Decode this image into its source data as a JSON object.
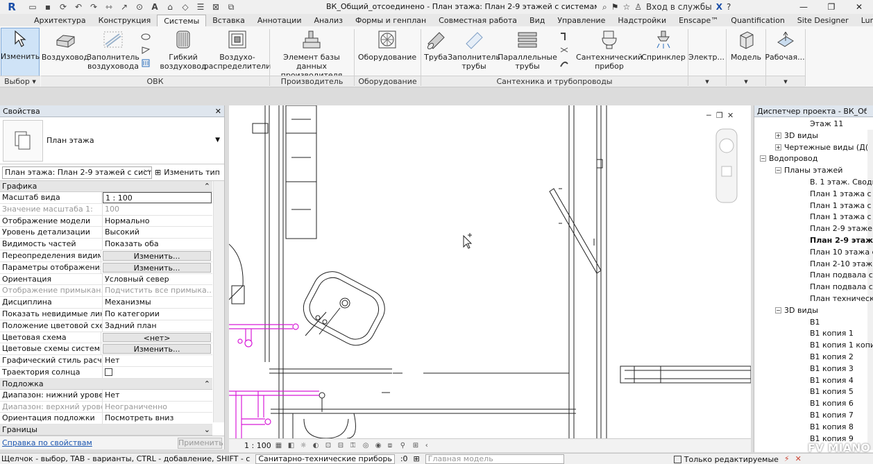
{
  "title_bar": {
    "logo": "R",
    "doc_title": "ВК_Общий_отсоединено - План этажа: План 2-9 этажей с системами В1, ...",
    "signin": "Вход в службы",
    "help": "?"
  },
  "tabs": [
    "Архитектура",
    "Конструкция",
    "Системы",
    "Вставка",
    "Аннотации",
    "Анализ",
    "Формы и генплан",
    "Совместная работа",
    "Вид",
    "Управление",
    "Надстройки",
    "Enscape™",
    "Quantification",
    "Site Designer",
    "Lumion®"
  ],
  "active_tab": "Системы",
  "ribbon": {
    "modify": "Изменить",
    "select_group": "Выбор",
    "duct": "Воздуховод",
    "duct_fill": [
      "Заполнитель",
      "воздуховода"
    ],
    "flex_duct": [
      "Гибкий",
      "воздуховод"
    ],
    "air_term": [
      "Воздухо-",
      "распределители"
    ],
    "hvac_group": "ОВК",
    "fabrication": [
      "Элемент базы данных",
      "производителя"
    ],
    "fabrication_group": "Производитель",
    "equipment": "Оборудование",
    "equipment_group": "Оборудование",
    "pipe": "Труба",
    "pipe_fill": [
      "Заполнитель",
      "трубы"
    ],
    "parallel_pipes": [
      "Параллельные",
      "трубы"
    ],
    "fixture": [
      "Сантехнический",
      "прибор"
    ],
    "sprinkler": "Спринклер",
    "plumbing_group": "Сантехника и трубопроводы",
    "electrical": "Электр...",
    "model": "Модель",
    "workplane": "Рабочая..."
  },
  "properties": {
    "title": "Свойства",
    "type_name": "План этажа",
    "instance": "План этажа: План 2-9 этажей с систем",
    "edit_type": "Изменить тип",
    "sections": [
      {
        "name": "Графика",
        "rows": [
          {
            "k": "Масштаб вида",
            "v": "1 : 100",
            "style": "input"
          },
          {
            "k": "Значение масштаба    1:",
            "v": "100",
            "style": "dim"
          },
          {
            "k": "Отображение модели",
            "v": "Нормально"
          },
          {
            "k": "Уровень детализации",
            "v": "Высокий"
          },
          {
            "k": "Видимость частей",
            "v": "Показать оба"
          },
          {
            "k": "Переопределения видим...",
            "v": "Изменить...",
            "style": "btn"
          },
          {
            "k": "Параметры отображения...",
            "v": "Изменить...",
            "style": "btn"
          },
          {
            "k": "Ориентация",
            "v": "Условный север"
          },
          {
            "k": "Отображение примыкан...",
            "v": "Подчистить все примыка...",
            "style": "dim"
          },
          {
            "k": "Дисциплина",
            "v": "Механизмы"
          },
          {
            "k": "Показать невидимые лин...",
            "v": "По категории"
          },
          {
            "k": "Положение цветовой схе...",
            "v": "Задний план"
          },
          {
            "k": "Цветовая схема",
            "v": "<нет>",
            "style": "btn"
          },
          {
            "k": "Цветовые схемы системы",
            "v": "Изменить...",
            "style": "btn"
          },
          {
            "k": "Графический стиль расч...",
            "v": "Нет"
          },
          {
            "k": "Траектория солнца",
            "v": "",
            "style": "check"
          }
        ]
      },
      {
        "name": "Подложка",
        "rows": [
          {
            "k": "Диапазон: нижний уровень",
            "v": "Нет"
          },
          {
            "k": "Диапазон: верхний уровен...",
            "v": "Неограниченно",
            "style": "dim"
          },
          {
            "k": "Ориентация подложки",
            "v": "Посмотреть вниз"
          }
        ]
      },
      {
        "name": "Границы",
        "rows": []
      }
    ],
    "help_link": "Справка по свойствам",
    "apply": "Применить"
  },
  "view_control": {
    "scale": "1 : 100"
  },
  "browser": {
    "title": "Диспетчер проекта - ВК_Общи...",
    "nodes": [
      {
        "t": "Этаж 11",
        "lvl": 4
      },
      {
        "t": "3D виды",
        "lvl": 2,
        "tog": "+"
      },
      {
        "t": "Чертежные виды (Д(",
        "lvl": 2,
        "tog": "+"
      },
      {
        "t": "Водопровод",
        "lvl": 1,
        "tog": "−"
      },
      {
        "t": "Планы этажей",
        "lvl": 2,
        "tog": "−"
      },
      {
        "t": "В. 1 этаж. Сводны",
        "lvl": 4
      },
      {
        "t": "План 1 этажа с сі",
        "lvl": 4
      },
      {
        "t": "План 1 этажа с сі",
        "lvl": 4
      },
      {
        "t": "План 1 этажа с сі",
        "lvl": 4
      },
      {
        "t": "План 2-9 этажей",
        "lvl": 4
      },
      {
        "t": "План 2-9 этажей",
        "lvl": 4,
        "bold": true
      },
      {
        "t": "План 10 этажа с",
        "lvl": 4
      },
      {
        "t": "План  2-10 этаже",
        "lvl": 4
      },
      {
        "t": "План подвала с с",
        "lvl": 4
      },
      {
        "t": "План подвала с с",
        "lvl": 4
      },
      {
        "t": "План техническо",
        "lvl": 4
      },
      {
        "t": "3D виды",
        "lvl": 2,
        "tog": "−"
      },
      {
        "t": "В1",
        "lvl": 4
      },
      {
        "t": "В1 копия 1",
        "lvl": 4
      },
      {
        "t": "В1 копия 1 копия",
        "lvl": 4
      },
      {
        "t": "В1 копия 2",
        "lvl": 4
      },
      {
        "t": "В1 копия 3",
        "lvl": 4
      },
      {
        "t": "В1 копия 4",
        "lvl": 4
      },
      {
        "t": "В1 копия 5",
        "lvl": 4
      },
      {
        "t": "В1 копия 6",
        "lvl": 4
      },
      {
        "t": "В1 копия 7",
        "lvl": 4
      },
      {
        "t": "В1 копия 8",
        "lvl": 4
      },
      {
        "t": "В1 копия 9",
        "lvl": 4
      }
    ]
  },
  "status_bar": {
    "hint": "Щелчок - выбор, TAB - варианты, CTRL - добавление, SHIFT - с",
    "category": "Санитарно-технические приборь",
    "count": ":0",
    "model": "Главная модель",
    "editable_only": "Только редактируемые"
  },
  "watermark": "FV MIANO",
  "colors": {
    "selection": "#cfe3f7",
    "pipe_magenta": "#d81ad8",
    "drawing_line": "#222222"
  }
}
